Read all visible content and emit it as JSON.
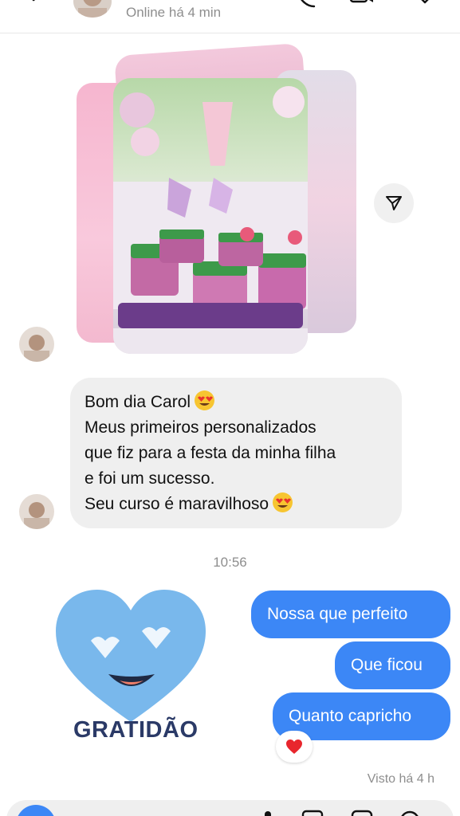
{
  "header": {
    "status": "Online há 4 min",
    "icons": [
      "back-arrow-icon",
      "phone-icon",
      "video-call-icon",
      "heart-icon"
    ]
  },
  "thread": {
    "shared_post": {
      "icon": "send-share-icon"
    },
    "incoming_message": {
      "lines": [
        "Bom dia Carol",
        "Meus primeiros personalizados",
        "que fiz para a festa da minha filha",
        "e foi um sucesso.",
        "Seu curso é maravilhoso"
      ],
      "emoji": "heart-eyes-emoji"
    },
    "timestamp": "10:56",
    "sticker": {
      "text": "GRATIDÃO",
      "icon": "heart-eyes-heart-sticker"
    },
    "outgoing_messages": [
      {
        "text": "Nossa que perfeito"
      },
      {
        "text": "Que ficou"
      },
      {
        "text": "Quanto capricho"
      }
    ],
    "reaction": "red-heart-icon",
    "seen": "Visto há 4 h"
  },
  "colors": {
    "outgoing_bubble": "#3c87f6",
    "incoming_bubble": "#efefef",
    "meta_text": "#8e8e8e",
    "sticker_heart": "#79b8ec",
    "sticker_text": "#2b3a67"
  }
}
